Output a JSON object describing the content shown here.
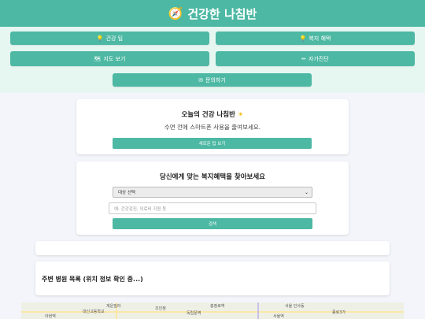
{
  "header": {
    "title": "건강한 나침반",
    "icon": "compass-icon"
  },
  "menu": {
    "tips": {
      "icon": "lightbulb-icon",
      "label": "건강 팁"
    },
    "welfare": {
      "icon": "lightbulb-icon",
      "label": "복지 혜택"
    },
    "map": {
      "icon": "map-icon",
      "label": "지도 보기"
    },
    "selfcheck": {
      "icon": "pencil-icon",
      "label": "자가진단"
    },
    "contact": {
      "icon": "envelope-icon",
      "label": "문의하기"
    }
  },
  "daily": {
    "title": "오늘의 건강 나침반",
    "sun": "☀",
    "tip": "수면 전에 스마트폰 사용을 줄여보세요.",
    "button": "새로운 팁 보기"
  },
  "welfare_search": {
    "title": "당신에게 맞는 복지혜택을 찾아보세요",
    "select_value": "대상 선택",
    "input_placeholder": "예: 건강검진, 의료비 지원 등",
    "button": "검색"
  },
  "hospitals": {
    "title": "주변 병원 목록 (위치 정보 확인 중...)"
  },
  "map_labels": [
    "계운빌라",
    "대신고등학교",
    "조인정",
    "독립문역",
    "충정로역",
    "서울 인사동",
    "종로3가",
    "아현역",
    "서울역"
  ],
  "colors": {
    "accent": "#4db8a3",
    "menu_bg": "#e6f6f1",
    "page_bg": "#f4f5fb"
  }
}
